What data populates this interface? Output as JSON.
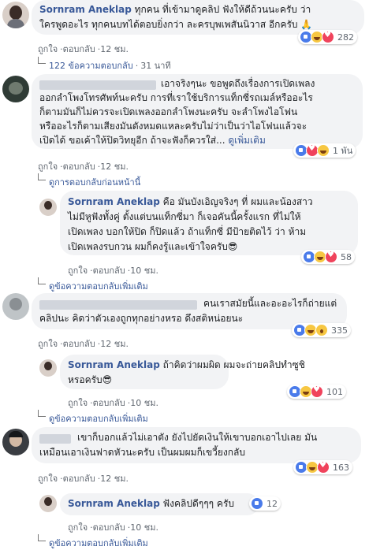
{
  "comment1": {
    "author": "Sornram Aneklap",
    "text_line1": "ทุกคน ที่เข้ามาดูคลิป ฟังให้ดีถ้วนนะครับ ว่า",
    "text_line2": "ใครพูดอะไร ทุกคนบทได้ตอบยิ่งกว่า ละครบุพเพสันนิวาส อีกครับ 🙏",
    "like": "ถูกใจ",
    "reply": "ตอบกลับ",
    "time": "12 ชม.",
    "reactions": "282",
    "replies_link": "122 ข้อความตอบกลับ",
    "replies_time": "31 นาที"
  },
  "comment2": {
    "text_line1": "เอาจริงๆนะ ขอพูดถึงเรื่องการเปิดเพลง",
    "text_line2": "ออกลำโพงโทรศัพท์นะครับ การที่เราใช้บริการแท็กซี่รถเมล์หรืออะไร",
    "text_line3": "ก็ตามมันก็ไม่ควรจะเปิดเพลงออกลำโพงนะครับ จะลำโพงไอโฟน",
    "text_line4": "หรืออะไรก็ตามเสียงมันดังหมดแหละครับไม่ว่าเป็นว่าไอโฟนแล้วจะ",
    "text_line5": "เปิดได้ ขอเค้าให้ปิดวิทยุอีก ถ้าจะฟังก็ควรใส่...",
    "see_more": "ดูเพิ่มเติม",
    "like": "ถูกใจ",
    "reply": "ตอบกลับ",
    "time": "12 ชม.",
    "reactions": "1 พัน",
    "earlier_replies": "ดูการตอบกลับก่อนหน้านี้"
  },
  "reply2": {
    "author": "Sornram Aneklap",
    "text_line1": "คือ มันบังเอิญจริงๆ ที่ ผมและน้องสาว",
    "text_line2": "ไม่มีหูฟังทั้งคู่ ตั้งแต่บนแท็กซี่มา ก็เจอคันนี้ครั้งแรก ที่ไม่ให้",
    "text_line3": "เปิดเพลง บอกให้ปิด ก็ปิดแล้ว ถ้าแท็กซี่ มีป้ายติดไว้ ว่า ห้าม",
    "text_line4": "เปิดเพลงรบกวน ผมก็คงรู้และเข้าใจครับ😎",
    "like": "ถูกใจ",
    "reply": "ตอบกลับ",
    "time": "10 ชม.",
    "reactions": "58",
    "more_replies": "ดูข้อความตอบกลับเพิ่มเติม"
  },
  "comment3": {
    "text_line1": "คนเราสมัยนี้และอะอะไรก็ถ่ายแต่",
    "text_line2": "คลิปนะ คิดว่าตัวเองถูกทุกอย่างหรอ ดึงสติหน่อยนะ",
    "like": "ถูกใจ",
    "reply": "ตอบกลับ",
    "time": "12 ชม.",
    "reactions": "335"
  },
  "reply3": {
    "author": "Sornram Aneklap",
    "text_line1": "ถ้าคิดว่าผมผิด ผมจะถ่ายคลิปทำซูชิ",
    "text_line2": "หรอครับ😎",
    "like": "ถูกใจ",
    "reply": "ตอบกลับ",
    "time": "10 ชม.",
    "reactions": "101",
    "more_replies": "ดูข้อความตอบกลับเพิ่มเติม"
  },
  "comment4": {
    "text_line1": "เขาก็บอกแล้วไม่เอาตัง ยังไปยัดเงินให้เขาบอกเอาไปเลย มัน",
    "text_line2": "เหมือนเอาเงินฟาดหัวนะครับ เป็นผมผมก็เขวี้ยงกลับ",
    "like": "ถูกใจ",
    "reply": "ตอบกลับ",
    "time": "12 ชม.",
    "reactions": "163"
  },
  "reply4": {
    "author": "Sornram Aneklap",
    "text": "ฟังคลิปดีๆๆๆ ครับ",
    "like": "ถูกใจ",
    "reply": "ตอบกลับ",
    "time": "10 ชม.",
    "reactions": "12",
    "more_replies": "ดูข้อความตอบกลับเพิ่มเติม"
  }
}
